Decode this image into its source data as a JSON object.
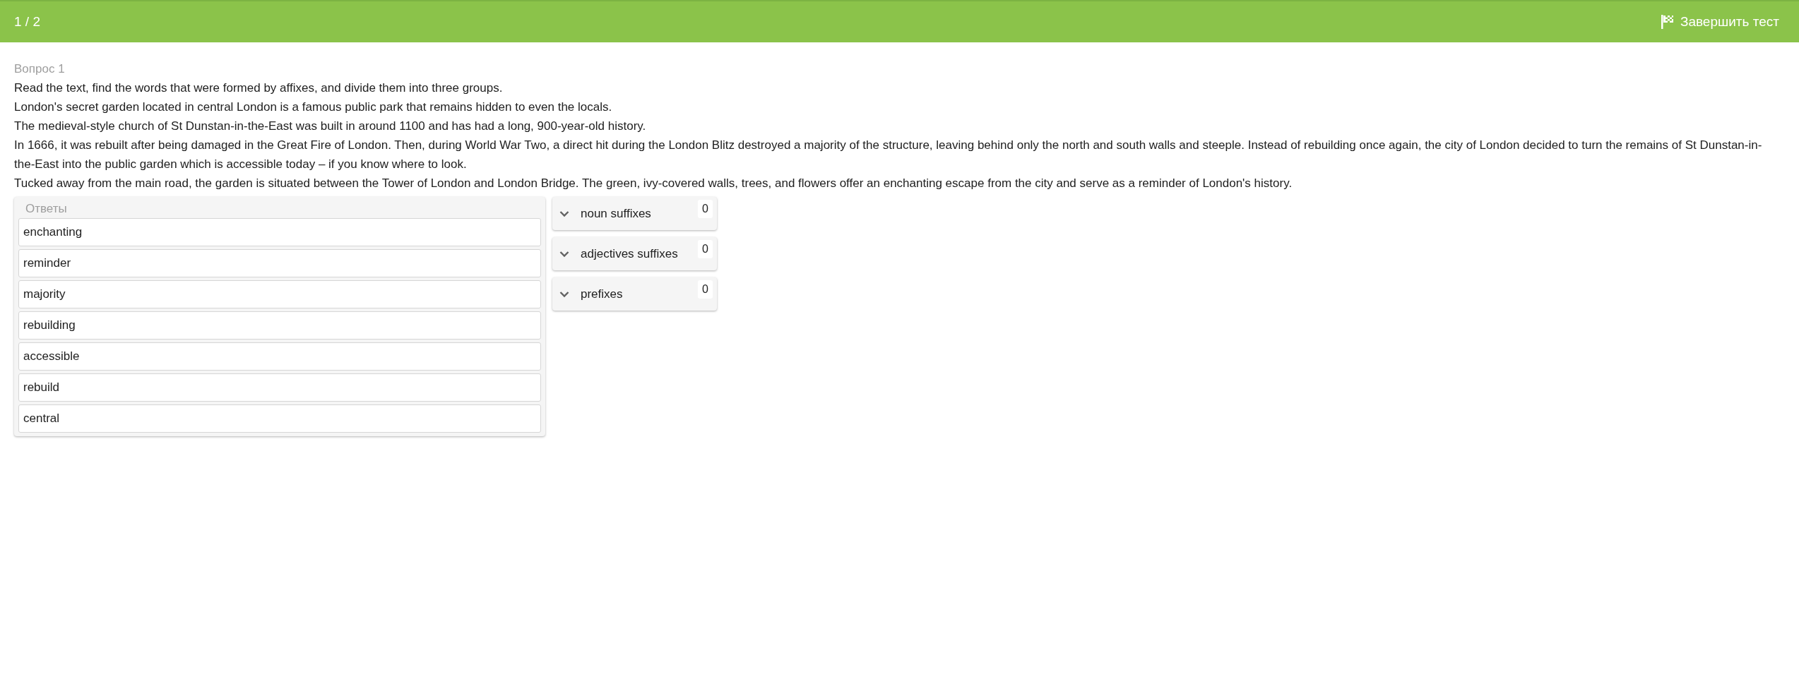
{
  "header": {
    "progress": "1 / 2",
    "finish_button": "Завершить тест"
  },
  "question": {
    "label": "Вопрос 1",
    "paragraphs": [
      "Read the text, find the words that were formed by affixes, and divide them into three groups.",
      "London's secret garden located in central London is a famous public park that remains hidden to even the locals.",
      "The medieval-style church of St Dunstan-in-the-East was built in  around 1100 and has had a long, 900-year-old history.",
      "In 1666, it was rebuilt after being damaged in the Great Fire of London. Then, during World War Two, a direct hit during the London Blitz destroyed a majority of the structure, leaving behind only the north and south walls and steeple. Instead of rebuilding once again, the city of London decided to turn the remains of St Dunstan-in-the-East into the public garden which is accessible today – if you know where to look.",
      "Tucked away from the main road, the garden is situated between the Tower of London and London Bridge. The green, ivy-covered walls, trees, and flowers offer an enchanting escape from the city and serve as a reminder of London's history."
    ]
  },
  "answers": {
    "title": "Ответы",
    "items": [
      "enchanting",
      "reminder",
      "majority",
      "rebuilding",
      "accessible",
      "rebuild",
      "central"
    ]
  },
  "groups": [
    {
      "label": "noun suffixes",
      "count": "0",
      "expanded": false
    },
    {
      "label": "adjectives suffixes",
      "count": "0",
      "expanded": false
    },
    {
      "label": "prefixes",
      "count": "0",
      "expanded": false
    }
  ]
}
